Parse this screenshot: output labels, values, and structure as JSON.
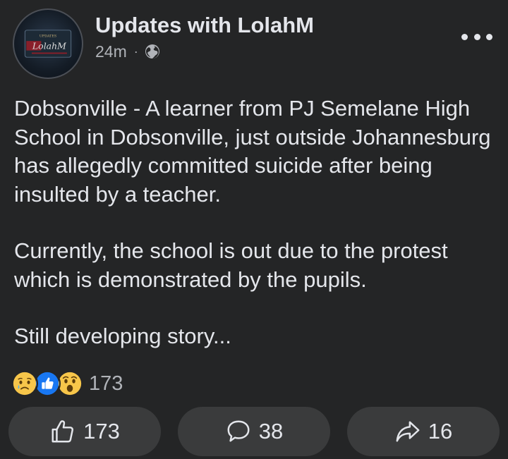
{
  "post": {
    "page_name": "Updates with LolahM",
    "time": "24m",
    "separator": "·",
    "audience_icon": "globe-icon",
    "avatar_logo_text": "LolahM",
    "paragraphs": [
      "Dobsonville - A learner from PJ Semelane High School in Dobsonville, just outside Johannesburg has allegedly committed suicide after being insulted by a teacher.",
      "Currently, the school is out due to the protest which is demonstrated by the pupils.",
      "Still developing story..."
    ]
  },
  "reactions": {
    "icons": [
      "sad-reaction-icon",
      "like-reaction-icon",
      "wow-reaction-icon"
    ],
    "total": "173"
  },
  "actions": {
    "like_count": "173",
    "comment_count": "38",
    "share_count": "16"
  },
  "colors": {
    "background": "#242526",
    "button_bg": "#3a3b3c",
    "text_primary": "#e4e6eb",
    "text_secondary": "#b0b3b8",
    "like_blue": "#1877f2",
    "emoji_yellow": "#f7c64a"
  }
}
